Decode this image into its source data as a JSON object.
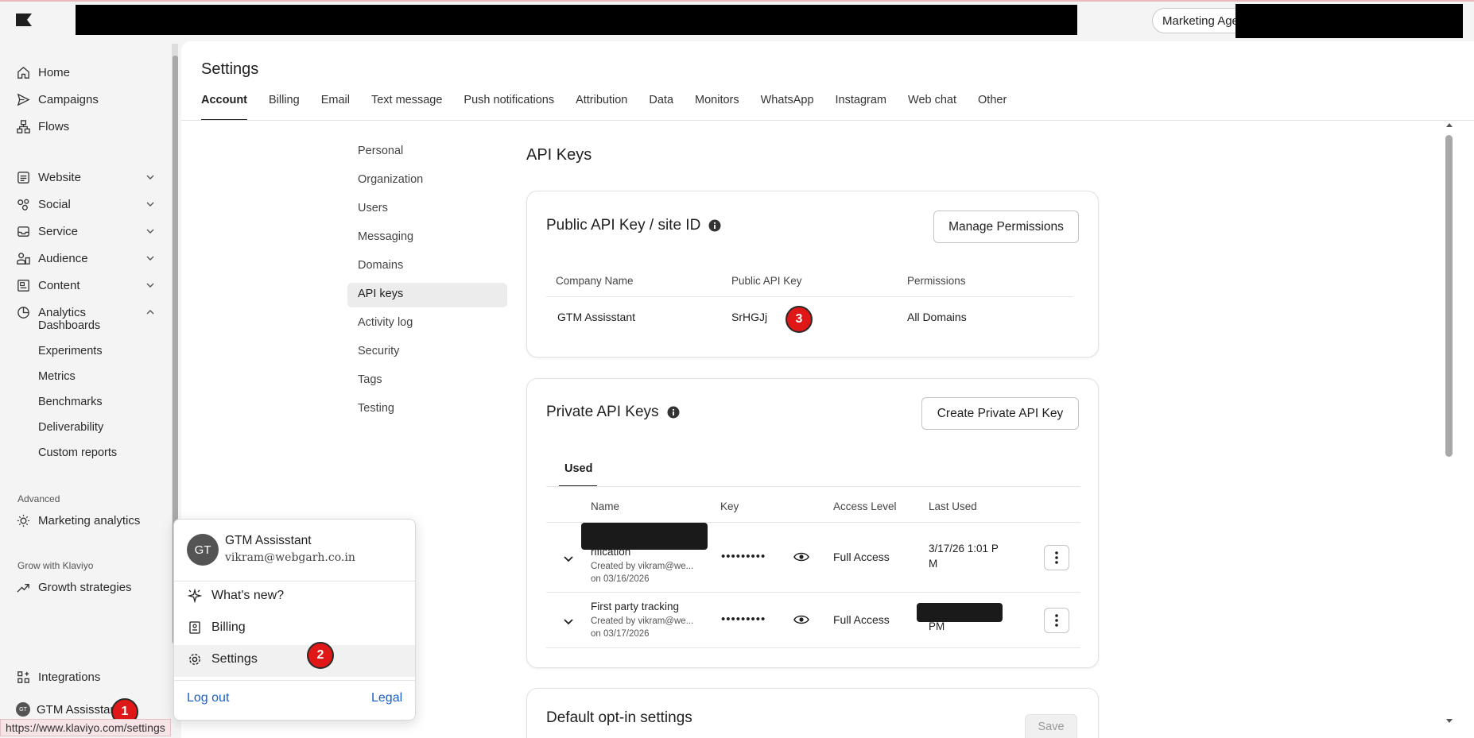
{
  "topbar": {
    "account_label": "Marketing Age"
  },
  "sidebar": {
    "items": [
      {
        "label": "Home",
        "icon": "home-icon"
      },
      {
        "label": "Campaigns",
        "icon": "send-icon"
      },
      {
        "label": "Flows",
        "icon": "flows-icon"
      },
      {
        "label": "Website",
        "icon": "website-icon"
      },
      {
        "label": "Social",
        "icon": "social-icon"
      },
      {
        "label": "Service",
        "icon": "inbox-icon"
      },
      {
        "label": "Audience",
        "icon": "audience-icon"
      },
      {
        "label": "Content",
        "icon": "content-icon"
      },
      {
        "label": "Analytics",
        "icon": "analytics-icon"
      }
    ],
    "analytics_sub": [
      "Dashboards",
      "Experiments",
      "Metrics",
      "Benchmarks",
      "Deliverability",
      "Custom reports"
    ],
    "advanced_label": "Advanced",
    "marketing_analytics": "Marketing analytics",
    "grow_label": "Grow with Klaviyo",
    "growth_strategies": "Growth strategies",
    "integrations": "Integrations",
    "user_name": "GTM Assisstant",
    "user_initials": "GT"
  },
  "page": {
    "title": "Settings",
    "tabs": [
      "Account",
      "Billing",
      "Email",
      "Text message",
      "Push notifications",
      "Attribution",
      "Data",
      "Monitors",
      "WhatsApp",
      "Instagram",
      "Web chat",
      "Other"
    ],
    "active_tab": "Account"
  },
  "subnav": [
    "Personal",
    "Organization",
    "Users",
    "Messaging",
    "Domains",
    "API keys",
    "Activity log",
    "Security",
    "Tags",
    "Testing"
  ],
  "api": {
    "heading": "API Keys",
    "public": {
      "title": "Public API Key / site ID",
      "manage_button": "Manage Permissions",
      "headers": [
        "Company Name",
        "Public API Key",
        "Permissions"
      ],
      "row": {
        "company": "GTM Assisstant",
        "key": "SrHGJj",
        "permissions": "All Domains"
      }
    },
    "private": {
      "title": "Private API Keys",
      "create_button": "Create Private API Key",
      "tab": "Used",
      "headers": [
        "Name",
        "Key",
        "Access Level",
        "Last Used"
      ],
      "rows": [
        {
          "name": "rification",
          "created_by": "Created by vikram@we...",
          "created_on": "on 03/16/2026",
          "key": "•••••••••",
          "access": "Full Access",
          "last_used_1": "3/17/26 1:01 P",
          "last_used_2": "M"
        },
        {
          "name": "First party tracking",
          "created_by": "Created by vikram@we...",
          "created_on": "on 03/17/2026",
          "key": "•••••••••",
          "access": "Full Access",
          "last_used_1": "",
          "last_used_2": "PM"
        }
      ]
    },
    "optin": {
      "title": "Default opt-in settings",
      "save_button": "Save"
    }
  },
  "popover": {
    "name": "GTM Assisstant",
    "email": "vikram@webgarh.co.in",
    "initials": "GT",
    "items": [
      "What's new?",
      "Billing",
      "Settings"
    ],
    "logout": "Log out",
    "legal": "Legal"
  },
  "badges": [
    "1",
    "2",
    "3"
  ],
  "status_url": "https://www.klaviyo.com/settings"
}
